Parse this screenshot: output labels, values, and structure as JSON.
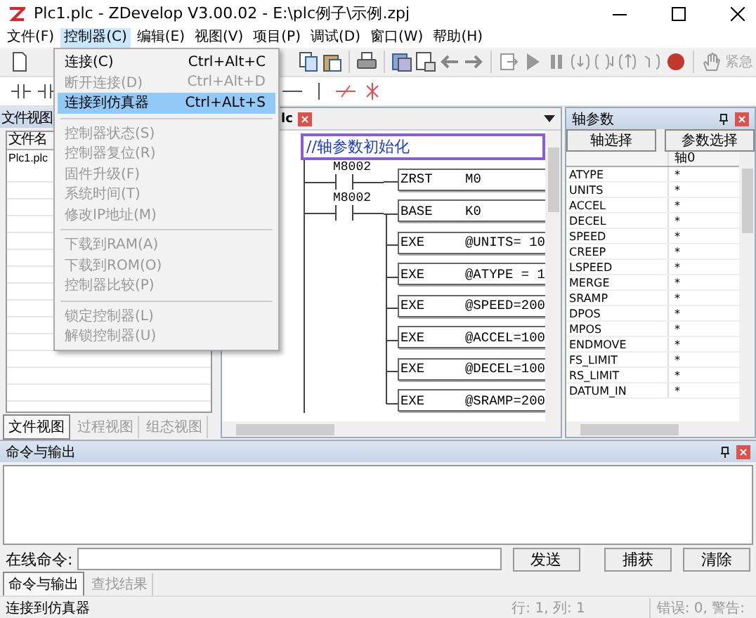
{
  "window": {
    "title": "Plc1.plc - ZDevelop V3.00.02 - E:\\plc例子\\示例.zpj"
  },
  "menu_bar": [
    {
      "label": "文件(F)",
      "selected": false
    },
    {
      "label": "控制器(C)",
      "selected": true
    },
    {
      "label": "编辑(E)",
      "selected": false
    },
    {
      "label": "视图(V)",
      "selected": false
    },
    {
      "label": "项目(P)",
      "selected": false
    },
    {
      "label": "调试(D)",
      "selected": false
    },
    {
      "label": "窗口(W)",
      "selected": false
    },
    {
      "label": "帮助(H)",
      "selected": false
    }
  ],
  "controller_menu": [
    {
      "kind": "item",
      "label": "连接(C)",
      "shortcut": "Ctrl+Alt+C",
      "disabled": false,
      "selected": false
    },
    {
      "kind": "item",
      "label": "断开连接(D)",
      "shortcut": "Ctrl+Alt+D",
      "disabled": true,
      "selected": false
    },
    {
      "kind": "item",
      "label": "连接到仿真器",
      "shortcut": "Ctrl+ALt+S",
      "disabled": false,
      "selected": true
    },
    {
      "kind": "separator"
    },
    {
      "kind": "item",
      "label": "控制器状态(S)",
      "disabled": true,
      "selected": false
    },
    {
      "kind": "item",
      "label": "控制器复位(R)",
      "disabled": true,
      "selected": false
    },
    {
      "kind": "item",
      "label": "固件升级(F)",
      "disabled": true,
      "selected": false
    },
    {
      "kind": "item",
      "label": "系统时间(T)",
      "disabled": true,
      "selected": false
    },
    {
      "kind": "item",
      "label": "修改IP地址(M)",
      "disabled": true,
      "selected": false
    },
    {
      "kind": "separator"
    },
    {
      "kind": "item",
      "label": "下载到RAM(A)",
      "disabled": true,
      "selected": false
    },
    {
      "kind": "item",
      "label": "下载到ROM(O)",
      "disabled": true,
      "selected": false
    },
    {
      "kind": "item",
      "label": "控制器比较(P)",
      "disabled": true,
      "selected": false
    },
    {
      "kind": "separator"
    },
    {
      "kind": "item",
      "label": "锁定控制器(L)",
      "disabled": true,
      "selected": false
    },
    {
      "kind": "item",
      "label": "解锁控制器(U)",
      "disabled": true,
      "selected": false
    }
  ],
  "toolbar": {
    "emergency_label": "紧急"
  },
  "file_view": {
    "title": "文件视图",
    "column": "文件名",
    "files": [
      "Plc1.plc"
    ],
    "tabs": [
      {
        "label": "文件视图",
        "selected": true
      },
      {
        "label": "过程视图",
        "selected": false
      },
      {
        "label": "组态视图",
        "selected": false
      }
    ]
  },
  "editor": {
    "tab": "lc",
    "comment": "//轴参数初始化",
    "rungs": [
      {
        "contact": "M8002",
        "instruction": "ZRST",
        "operand": "M0"
      },
      {
        "contact": "M8002",
        "instruction": "BASE",
        "operand": "K0"
      },
      {
        "instruction": "EXE",
        "operand": "@UNITS= 10"
      },
      {
        "instruction": "EXE",
        "operand": "@ATYPE = 1"
      },
      {
        "instruction": "EXE",
        "operand": "@SPEED=200"
      },
      {
        "instruction": "EXE",
        "operand": "@ACCEL=100"
      },
      {
        "instruction": "EXE",
        "operand": "@DECEL=100"
      },
      {
        "instruction": "EXE",
        "operand": "@SRAMP=200"
      }
    ]
  },
  "axis_params": {
    "title": "轴参数",
    "buttons": [
      "轴选择",
      "参数选择"
    ],
    "column": "轴0",
    "rows": [
      {
        "name": "ATYPE",
        "value": "*"
      },
      {
        "name": "UNITS",
        "value": "*"
      },
      {
        "name": "ACCEL",
        "value": "*"
      },
      {
        "name": "DECEL",
        "value": "*"
      },
      {
        "name": "SPEED",
        "value": "*"
      },
      {
        "name": "CREEP",
        "value": "*"
      },
      {
        "name": "LSPEED",
        "value": "*"
      },
      {
        "name": "MERGE",
        "value": "*"
      },
      {
        "name": "SRAMP",
        "value": "*"
      },
      {
        "name": "DPOS",
        "value": "*"
      },
      {
        "name": "MPOS",
        "value": "*"
      },
      {
        "name": "ENDMOVE",
        "value": "*"
      },
      {
        "name": "FS_LIMIT",
        "value": "*"
      },
      {
        "name": "RS_LIMIT",
        "value": "*"
      },
      {
        "name": "DATUM_IN",
        "value": "*"
      }
    ]
  },
  "output": {
    "title": "命令与输出",
    "command_label": "在线命令:",
    "buttons": [
      "发送",
      "捕获",
      "清除"
    ],
    "tabs": [
      {
        "label": "命令与输出",
        "selected": true
      },
      {
        "label": "查找结果",
        "selected": false
      }
    ]
  },
  "status_bar": {
    "message": "连接到仿真器",
    "position": "行: 1, 列: 1",
    "errors": "错误: 0, 警告:"
  }
}
